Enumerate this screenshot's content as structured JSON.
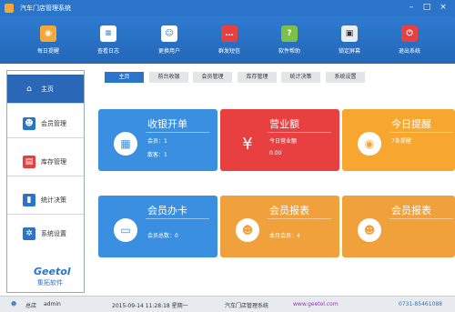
{
  "window": {
    "title": "汽车门店管理系统"
  },
  "toolbar": [
    {
      "label": "每日提醒",
      "icon": "bulb-icon"
    },
    {
      "label": "查看日志",
      "icon": "list-icon"
    },
    {
      "label": "更换用户",
      "icon": "user-icon"
    },
    {
      "label": "群发短信",
      "icon": "chat-icon"
    },
    {
      "label": "软件帮助",
      "icon": "help-icon"
    },
    {
      "label": "锁定屏幕",
      "icon": "lock-icon"
    },
    {
      "label": "退出系统",
      "icon": "power-icon"
    }
  ],
  "sidebar": [
    {
      "label": "主页",
      "icon": "home-icon"
    },
    {
      "label": "会员管理",
      "icon": "member-icon"
    },
    {
      "label": "库存管理",
      "icon": "inventory-icon"
    },
    {
      "label": "统计决策",
      "icon": "chart-icon"
    },
    {
      "label": "系统设置",
      "icon": "settings-icon"
    }
  ],
  "logo": {
    "brand": "Geetol",
    "sub": "集拓软件"
  },
  "tabs": [
    "主页",
    "前台收银",
    "会员管理",
    "库存管理",
    "统计决策",
    "系统设置"
  ],
  "cards": {
    "cashier": {
      "title": "收银开单",
      "line1": "会员：1",
      "line2": "散客：1"
    },
    "revenue": {
      "title": "营业额",
      "line1": "今日营业额",
      "line2": "0.00"
    },
    "reminder": {
      "title": "今日提醒",
      "line1": "7条提醒"
    },
    "membership": {
      "title": "会员办卡",
      "line1": "会员总数：0"
    },
    "report1": {
      "title": "会员报表",
      "line1": "本月会员：4"
    },
    "report2": {
      "title": "会员报表"
    }
  },
  "status": {
    "role": "总店",
    "user": "admin",
    "datetime": "2015-09-14 11:28:18 星期一",
    "app": "汽车门店管理系统",
    "website": "www.geetol.com",
    "phone": "0731-85461088"
  },
  "colors": {
    "primary": "#2a74c9",
    "cashier": "#3a8fe0",
    "revenue": "#e84040",
    "reminder": "#f7a72f",
    "membership": "#3a8fe0",
    "report": "#f0a13b"
  }
}
